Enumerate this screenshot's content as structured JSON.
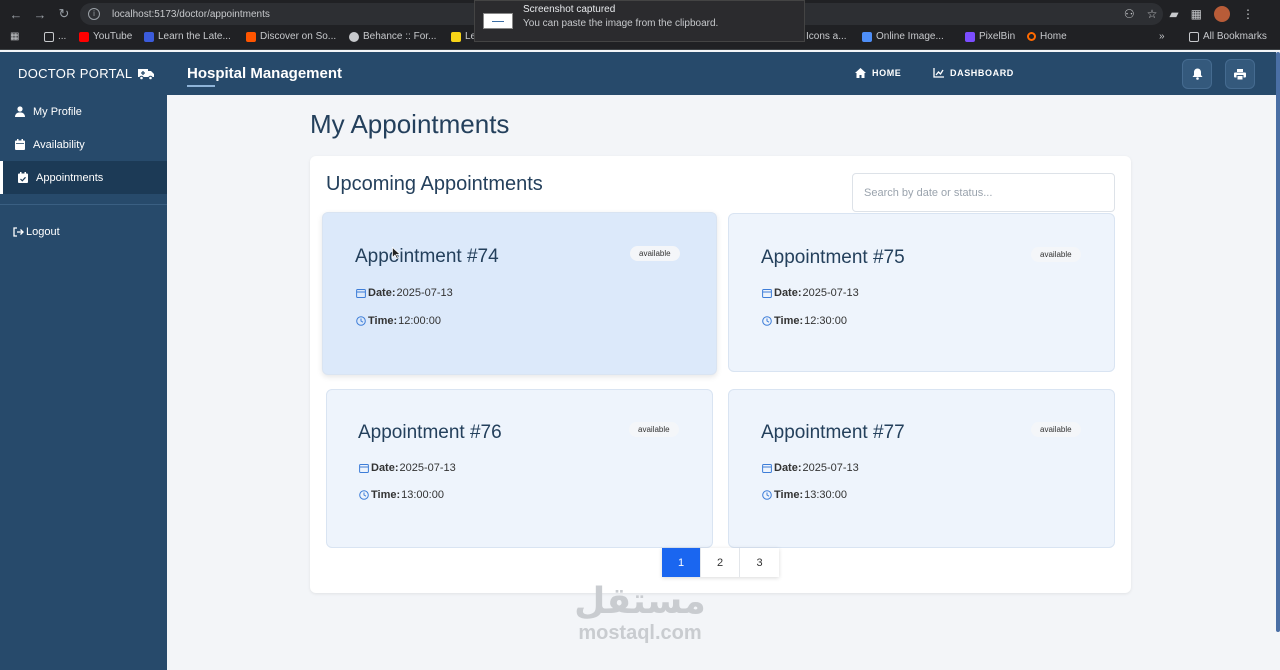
{
  "browser": {
    "url": "localhost:5173/doctor/appointments",
    "bookmarks": [
      {
        "label": "...",
        "color": "#9aa0a6"
      },
      {
        "label": "YouTube",
        "color": "#ff0000"
      },
      {
        "label": "Learn the Late...",
        "color": "#3b5bdb"
      },
      {
        "label": "Discover on So...",
        "color": "#ff5500"
      },
      {
        "label": "Behance :: For...",
        "color": "#c7c9cc"
      },
      {
        "label": "Le",
        "color": "#f7d417"
      },
      {
        "label": "Icons a...",
        "color": "#202124"
      },
      {
        "label": "Online Image...",
        "color": "#4e8ef7"
      },
      {
        "label": "PixelBin",
        "color": "#7b4dff"
      },
      {
        "label": "Home",
        "color": "#ff6a00"
      },
      {
        "label": "All Bookmarks",
        "color": "#c7c9cc"
      }
    ],
    "overflow": "»"
  },
  "toast": {
    "title": "Screenshot captured",
    "message": "You can paste the image from the clipboard."
  },
  "header": {
    "brand": "DOCTOR PORTAL",
    "title": "Hospital Management",
    "nav": [
      {
        "label": "HOME",
        "icon": "home-icon"
      },
      {
        "label": "DASHBOARD",
        "icon": "chart-line-icon"
      }
    ],
    "actions": [
      {
        "icon": "bell-icon"
      },
      {
        "icon": "print-icon"
      }
    ]
  },
  "sidebar": {
    "items": [
      {
        "label": "My Profile",
        "icon": "user-icon",
        "active": false
      },
      {
        "label": "Availability",
        "icon": "calendar-icon",
        "active": false
      },
      {
        "label": "Appointments",
        "icon": "calendar-check-icon",
        "active": true
      }
    ],
    "logout": "Logout"
  },
  "main": {
    "page_title": "My Appointments",
    "panel_title": "Upcoming Appointments",
    "search_placeholder": "Search by date or status...",
    "labels": {
      "date": "Date:",
      "time": "Time:"
    },
    "appointments": [
      {
        "title": "Appointment #74",
        "status": "available",
        "date": "2025-07-13",
        "time": "12:00:00"
      },
      {
        "title": "Appointment #75",
        "status": "available",
        "date": "2025-07-13",
        "time": "12:30:00"
      },
      {
        "title": "Appointment #76",
        "status": "available",
        "date": "2025-07-13",
        "time": "13:00:00"
      },
      {
        "title": "Appointment #77",
        "status": "available",
        "date": "2025-07-13",
        "time": "13:30:00"
      }
    ],
    "pagination": {
      "pages": [
        "1",
        "2",
        "3"
      ],
      "current": "1"
    }
  },
  "watermark": {
    "arabic": "مستقل",
    "latin": "mostaql.com"
  },
  "colors": {
    "accent": "#1a66f0",
    "header": "#274a6b",
    "sidebar_active": "#1c3a56",
    "card": "#eef4fc"
  }
}
